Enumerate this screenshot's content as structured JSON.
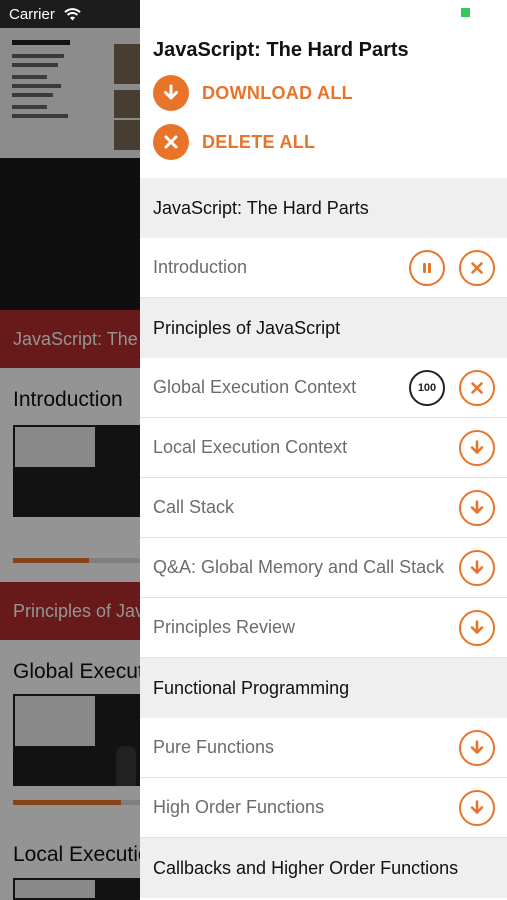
{
  "status": {
    "carrier": "Carrier"
  },
  "background": {
    "slide": {
      "lines": [
        "Will Sentance",
        "Academic work:",
        "Oxford, Harvard",
        "Currently:",
        "CEO & Cofounder",
        "Codesmith",
        "Previously:",
        "Cocreator @icecomm",
        "Software Engineer @Gem"
      ]
    },
    "sections": [
      {
        "label": "JavaScript: The Hard Parts"
      },
      {
        "label": "Principles of JavaScript"
      }
    ],
    "items": [
      {
        "title": "Introduction",
        "progress": 0.6
      },
      {
        "title": "Global Execution Context",
        "progress": 0.85
      },
      {
        "title": "Local Execution Context"
      }
    ]
  },
  "drawer": {
    "title": "JavaScript: The Hard Parts",
    "download_all": "DOWNLOAD ALL",
    "delete_all": "DELETE ALL",
    "rows": [
      {
        "type": "section",
        "label": "JavaScript: The Hard Parts"
      },
      {
        "type": "lesson",
        "label": "Introduction",
        "state": "downloading"
      },
      {
        "type": "section",
        "label": "Principles of JavaScript"
      },
      {
        "type": "lesson",
        "label": "Global Execution Context",
        "state": "downloaded",
        "percent": "100"
      },
      {
        "type": "lesson",
        "label": "Local Execution Context",
        "state": "available"
      },
      {
        "type": "lesson",
        "label": "Call Stack",
        "state": "available"
      },
      {
        "type": "lesson",
        "label": "Q&A: Global Memory and Call Stack",
        "state": "available"
      },
      {
        "type": "lesson",
        "label": "Principles Review",
        "state": "available"
      },
      {
        "type": "section",
        "label": "Functional Programming"
      },
      {
        "type": "lesson",
        "label": "Pure Functions",
        "state": "available"
      },
      {
        "type": "lesson",
        "label": "High Order Functions",
        "state": "available"
      },
      {
        "type": "section",
        "label": "Callbacks and Higher Order Functions"
      }
    ]
  },
  "colors": {
    "accent": "#e8742a",
    "section_bg": "#efefef",
    "brand_red": "#b32b2b"
  },
  "icons": {
    "download": "download-arrow-icon",
    "delete": "close-x-icon",
    "pause": "pause-icon",
    "wifi": "wifi-icon"
  }
}
